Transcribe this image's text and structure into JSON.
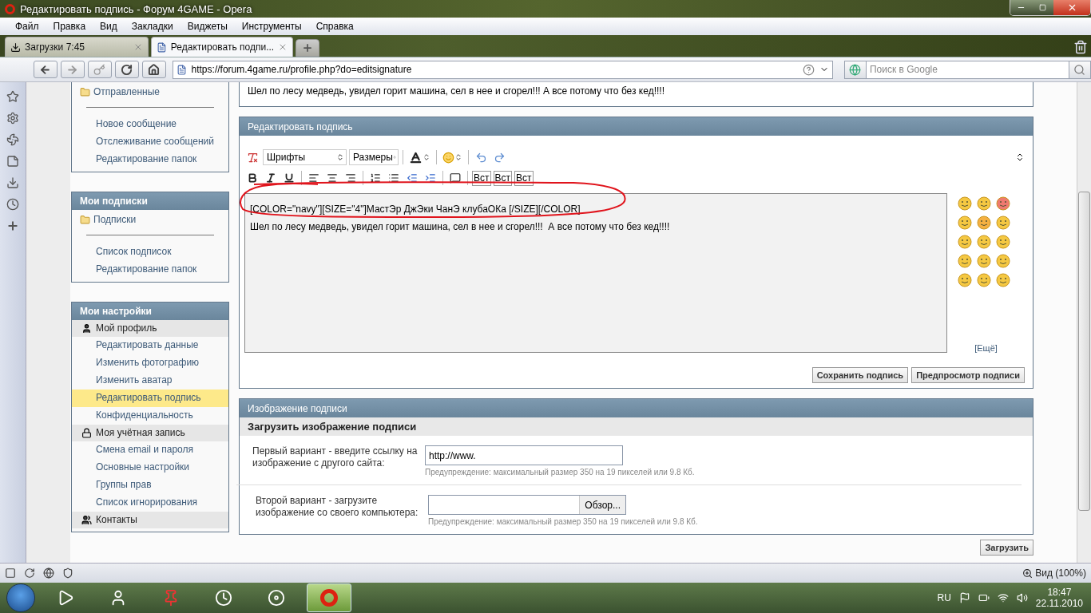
{
  "window": {
    "title": "Редактировать подпись - Форум 4GAME - Opera"
  },
  "menu": [
    "Файл",
    "Правка",
    "Вид",
    "Закладки",
    "Виджеты",
    "Инструменты",
    "Справка"
  ],
  "tabs": [
    {
      "kind": "downloads",
      "label": "Загрузки 7:45",
      "selected": false
    },
    {
      "kind": "page",
      "label": "Редактировать подпи...",
      "selected": true
    }
  ],
  "address_bar": {
    "url": "https://forum.4game.ru/profile.php?do=editsignature"
  },
  "search": {
    "placeholder": "Поиск в Google"
  },
  "sidebar": [
    {
      "kind": "folders",
      "folder": "Отправленные",
      "links": [
        "Новое сообщение",
        "Отслеживание сообщений",
        "Редактирование папок"
      ]
    },
    {
      "kind": "folders",
      "title": "Мои подписки",
      "folder": "Подписки",
      "links": [
        "Список подписок",
        "Редактирование папок"
      ]
    },
    {
      "kind": "settings",
      "title": "Мои настройки",
      "groups": [
        {
          "label": "Мой профиль",
          "links": [
            {
              "label": "Редактировать данные",
              "selected": false
            },
            {
              "label": "Изменить фотографию",
              "selected": false
            },
            {
              "label": "Изменить аватар",
              "selected": false
            },
            {
              "label": "Редактировать подпись",
              "selected": true
            },
            {
              "label": "Конфиденциальность",
              "selected": false
            }
          ]
        },
        {
          "label": "Моя учётная запись",
          "links": [
            {
              "label": "Смена email и пароля",
              "selected": false
            },
            {
              "label": "Основные настройки",
              "selected": false
            },
            {
              "label": "Группы прав",
              "selected": false
            },
            {
              "label": "Список игнорирования",
              "selected": false
            }
          ]
        },
        {
          "label": "Контакты"
        }
      ]
    }
  ],
  "signature_preview": "Шел по лесу медведь, увидел горит машина, сел в нее и сгорел!!! А все потому что без кед!!!!",
  "editor": {
    "title": "Редактировать подпись",
    "font_select": "Шрифты",
    "size_select": "Размеры",
    "insert_buttons": [
      "Вст",
      "Вст",
      "Вст"
    ],
    "value": "[COLOR=\"navy\"][SIZE=\"4\"]МастЭр ДжЭки ЧанЭ клубаОКа [/SIZE][/COLOR]\nШел по лесу медведь, увидел горит машина, сел в нее и сгорел!!!  А все потому что без кед!!!!",
    "smilies": [
      {
        "color": "#f5c842"
      },
      {
        "color": "#f5c842"
      },
      {
        "color": "#ef7a70"
      },
      {
        "color": "#f5c842"
      },
      {
        "color": "#f5b042"
      },
      {
        "color": "#f5c842"
      },
      {
        "color": "#f5c842"
      },
      {
        "color": "#f5c842"
      },
      {
        "color": "#f5c842"
      },
      {
        "color": "#f5c842"
      },
      {
        "color": "#f5c842"
      },
      {
        "color": "#f5c842"
      },
      {
        "color": "#f5c842"
      },
      {
        "color": "#f5c842"
      },
      {
        "color": "#f5c842"
      }
    ],
    "more_link": "[Ещё]",
    "buttons": [
      "Сохранить подпись",
      "Предпросмотр подписи"
    ]
  },
  "image_panel": {
    "title": "Изображение подписи",
    "subtitle": "Загрузить изображение подписи",
    "options": [
      {
        "kind": "url",
        "label": "Первый вариант - введите ссылку на изображение с другого сайта:",
        "value": "http://www.",
        "warning": "Предупреждение: максимальный размер 350 на 19 пикселей или 9.8 Кб."
      },
      {
        "kind": "file",
        "label": "Второй вариант - загрузите изображение со своего компьютера:",
        "button": "Обзор...",
        "warning": "Предупреждение: максимальный размер 350 на 19 пикселей или 9.8 Кб."
      }
    ],
    "upload_button": "Загрузить"
  },
  "status_bar": {
    "zoom": "Вид (100%)"
  },
  "taskbar": {
    "apps": [
      {
        "kind": "media",
        "selected": false
      },
      {
        "kind": "user",
        "selected": false
      },
      {
        "kind": "pin",
        "selected": false
      },
      {
        "kind": "clock",
        "selected": false
      },
      {
        "kind": "sound",
        "selected": false
      },
      {
        "kind": "opera",
        "selected": true
      }
    ],
    "language": "RU",
    "time": "18:47",
    "date": "22.11.2010"
  }
}
